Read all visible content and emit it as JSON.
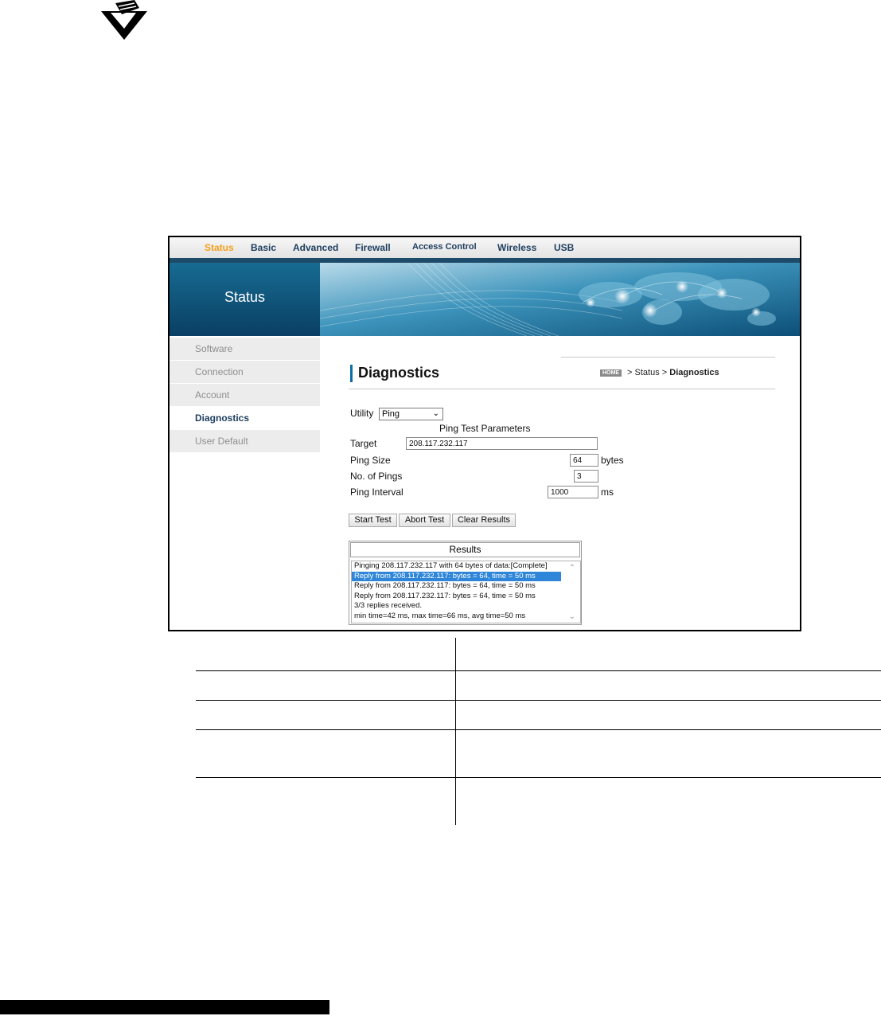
{
  "nav": {
    "items": [
      "Status",
      "Basic",
      "Advanced",
      "Firewall",
      "Access Control",
      "Wireless",
      "USB"
    ],
    "active": "Status"
  },
  "header": {
    "section_title": "Status"
  },
  "sidebar": {
    "items": [
      "Software",
      "Connection",
      "Account",
      "Diagnostics",
      "User Default"
    ],
    "active": "Diagnostics"
  },
  "page": {
    "title": "Diagnostics",
    "breadcrumb": {
      "home": "HOME",
      "sep1": " > Status > ",
      "current": "Diagnostics"
    }
  },
  "form": {
    "utility_label": "Utility",
    "utility_value": "Ping",
    "section_title": "Ping Test Parameters",
    "target_label": "Target",
    "target_value": "208.117.232.117",
    "ping_size_label": "Ping Size",
    "ping_size_value": "64",
    "ping_size_unit": "bytes",
    "num_pings_label": "No. of Pings",
    "num_pings_value": "3",
    "interval_label": "Ping Interval",
    "interval_value": "1000",
    "interval_unit": "ms"
  },
  "buttons": {
    "start": "Start Test",
    "abort": "Abort Test",
    "clear": "Clear Results"
  },
  "results": {
    "header": "Results",
    "lines": [
      "Pinging 208.117.232.117 with 64 bytes of data:[Complete]",
      "Reply from 208.117.232.117: bytes = 64, time = 50 ms",
      "Reply from 208.117.232.117: bytes = 64, time = 50 ms",
      "Reply from 208.117.232.117: bytes = 64, time = 50 ms",
      "3/3 replies received.",
      "min time=42 ms, max time=66 ms, avg time=50 ms"
    ],
    "selected_index": 1
  },
  "colors": {
    "accent": "#f4a01b",
    "nav_text": "#1d3d5e",
    "header_blue": "#0a3f63",
    "selection": "#2f86d8"
  },
  "icons": {
    "logo": "checkmark-hand-icon",
    "dropdown": "chevron-down-icon"
  }
}
